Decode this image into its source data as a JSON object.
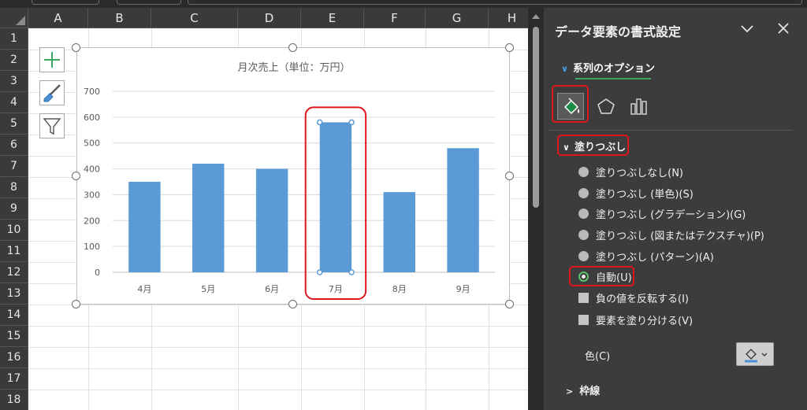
{
  "sheet": {
    "columns": [
      "A",
      "B",
      "C",
      "D",
      "E",
      "F",
      "G",
      "H"
    ],
    "rows": [
      "1",
      "2",
      "3",
      "4",
      "5",
      "6",
      "7",
      "8",
      "9",
      "10",
      "11",
      "12",
      "13",
      "14",
      "15",
      "16",
      "17",
      "18"
    ]
  },
  "chart_data": {
    "type": "bar",
    "title": "月次売上（単位：万円）",
    "categories": [
      "4月",
      "5月",
      "6月",
      "7月",
      "8月",
      "9月"
    ],
    "values": [
      350,
      420,
      400,
      580,
      310,
      480
    ],
    "ylim": [
      0,
      700
    ],
    "yticks": [
      0,
      100,
      200,
      300,
      400,
      500,
      600,
      700
    ],
    "xlabel": "",
    "ylabel": "",
    "grid": true,
    "bar_color": "#5b9bd5",
    "selected_category": "7月"
  },
  "pane": {
    "title": "データ要素の書式設定",
    "series_tab": "系列のオプション",
    "fill_section": "塗りつぶし",
    "fill_options": [
      "塗りつぶしなし(N)",
      "塗りつぶし (単色)(S)",
      "塗りつぶし (グラデーション)(G)",
      "塗りつぶし (図またはテクスチャ)(P)",
      "塗りつぶし (パターン)(A)"
    ],
    "auto_option": "自動(U)",
    "invert_option": "負の値を反転する(I)",
    "vary_option": "要素を塗り分ける(V)",
    "color_label": "色(C)",
    "border_section": "枠線"
  },
  "colors": {
    "accent_green": "#3aa860",
    "highlight_red": "#e0151b"
  },
  "icons": {
    "pane_dropdown": "chevron-down-icon",
    "pane_close": "close-icon",
    "chart_elements": "plus-icon",
    "chart_styles": "brush-icon",
    "chart_filters": "funnel-icon",
    "fill_line": "paint-bucket-icon",
    "effects": "pentagon-icon",
    "series_options": "bar-chart-icon"
  }
}
